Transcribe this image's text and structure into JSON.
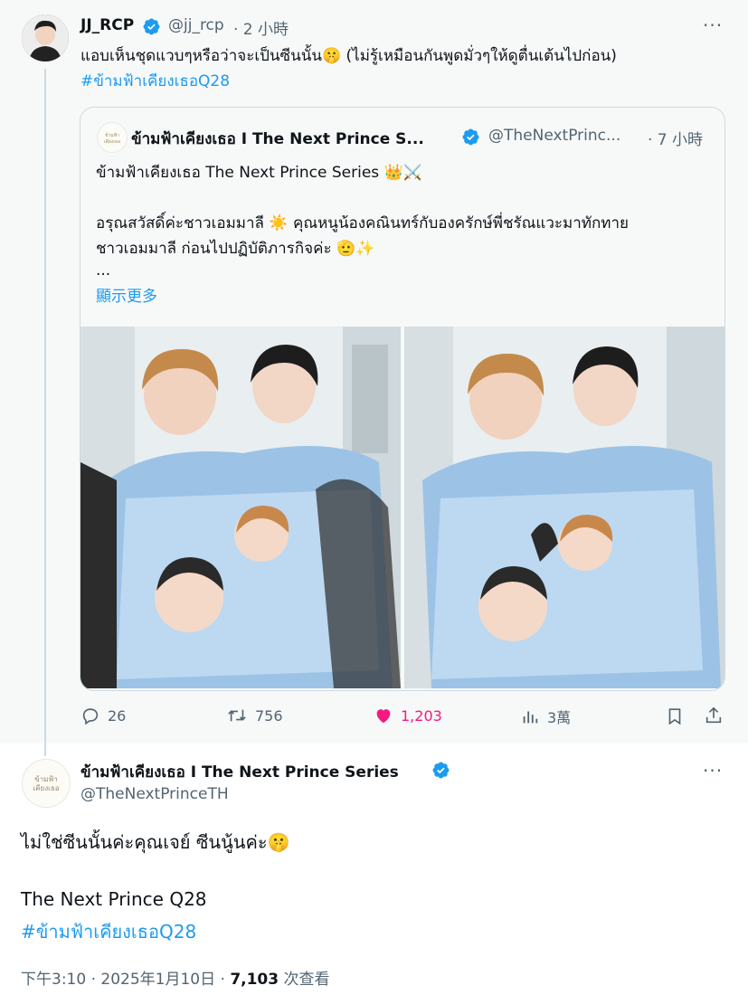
{
  "parent_tweet": {
    "display_name": "JJ_RCP",
    "handle": "@jj_rcp",
    "time": "· 2 小時",
    "text": "แอบเห็นชุดแวบๆหรือว่าจะเป็นซีนนั้น🤫 (ไม่รู้เหมือนกันพูดมั่วๆให้ดูตื่นเต้นไปก่อน)",
    "hashtag": "#ข้ามฟ้าเคียงเธอQ28",
    "more": "···",
    "quote": {
      "display_name": "ข้ามฟ้าเคียงเธอ I The Next Prince S...",
      "handle": "@TheNextPrinc...",
      "time": "· 7 小時",
      "line1": "ข้ามฟ้าเคียงเธอ The Next Prince Series 👑⚔️",
      "line2": "อรุณสวัสดิ์ค่ะชาวเอมมาลี ☀️  คุณหนูน้องคณินทร์กับองครักษ์พี่ชรัณแวะมาทักทาย",
      "line3": "ชาวเอมมาลี ก่อนไปปฏิบัติภารกิจค่ะ 🫡✨",
      "ellipsis": "...",
      "show_more": "顯示更多",
      "avatar_text": "ข้ามฟ้าเคียงเธอ"
    },
    "actions": {
      "replies": "26",
      "retweets": "756",
      "likes": "1,203",
      "views": "3萬"
    }
  },
  "reply_tweet": {
    "display_name": "ข้ามฟ้าเคียงเธอ I The Next Prince Series",
    "handle": "@TheNextPrinceTH",
    "more": "···",
    "avatar_text": "ข้ามฟ้าเคียงเธอ",
    "text_line1": "ไม่ใช่ซีนนั้นค่ะคุณเจย์ ซีนนู้นค่ะ🤫",
    "text_line2": "The Next Prince Q28",
    "hashtag": "#ข้ามฟ้าเคียงเธอQ28",
    "timestamp": "下午3:10 · 2025年1月10日 · ",
    "views_count": "7,103",
    "views_label": " 次查看"
  },
  "colors": {
    "accent": "#1d9bf0",
    "like": "#f91880",
    "muted": "#536471",
    "text": "#0f1419"
  }
}
